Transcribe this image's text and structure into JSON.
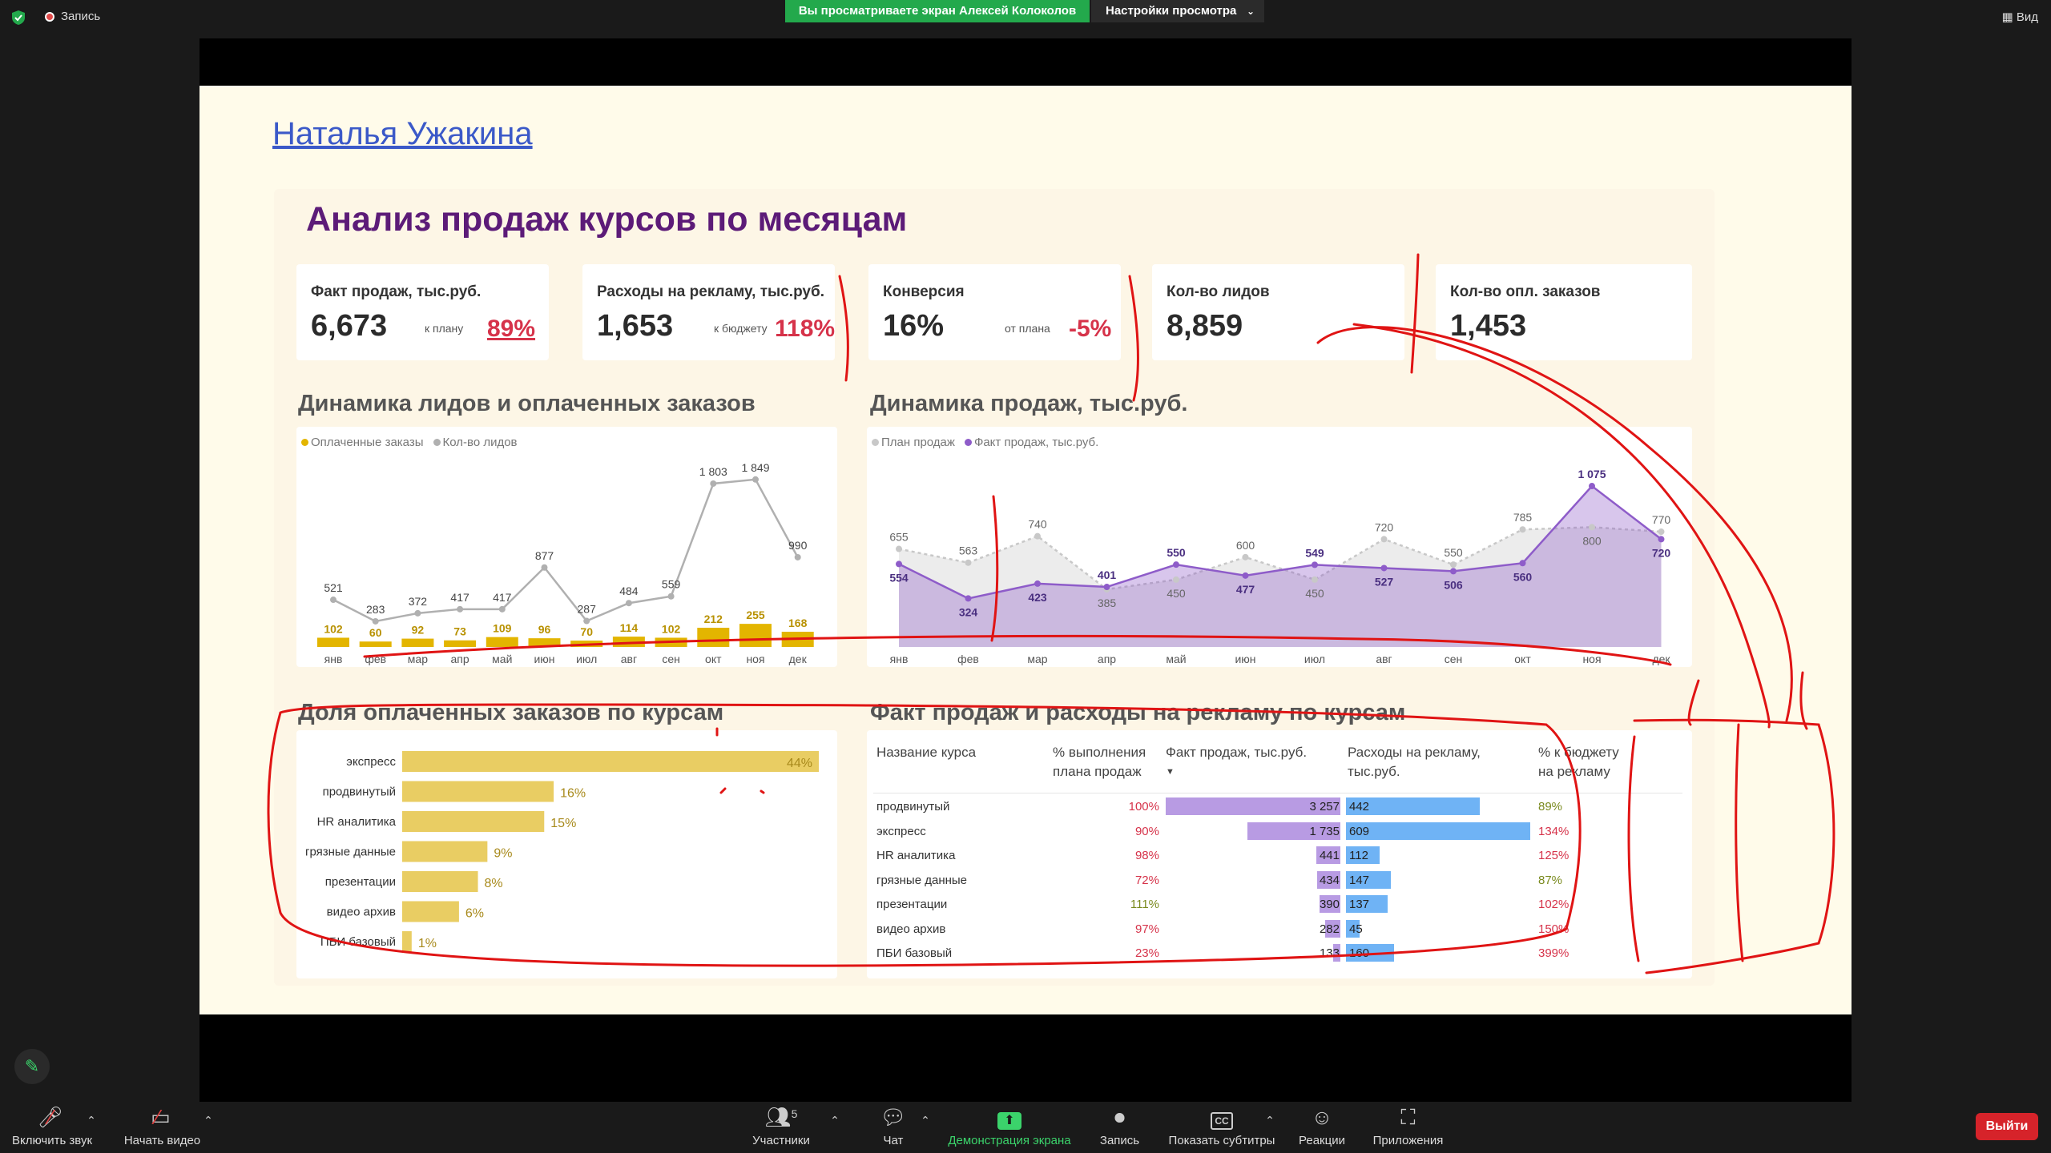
{
  "zoom": {
    "recording_label": "Запись",
    "banner_viewing": "Вы просматриваете экран Алексей Колоколов",
    "banner_settings": "Настройки просмотра",
    "view_label": "Вид",
    "toolbar": {
      "mute": "Включить звук",
      "video": "Начать видео",
      "participants": "Участники",
      "participants_count": "5",
      "chat": "Чат",
      "share": "Демонстрация экрана",
      "record": "Запись",
      "captions": "Показать субтитры",
      "reactions": "Реакции",
      "apps": "Приложения",
      "leave": "Выйти",
      "cc": "CC"
    },
    "colors": {
      "green": "#23a94c",
      "leave": "#d6232a"
    }
  },
  "slide": {
    "author": "Наталья Ужакина",
    "title": "Анализ продаж курсов по месяцам",
    "kpis": [
      {
        "label": "Факт продаж, тыс.руб.",
        "value": "6,673",
        "sub": "к плану",
        "pct": "89%"
      },
      {
        "label": "Расходы на рекламу, тыс.руб.",
        "value": "1,653",
        "sub": "к бюджету",
        "pct": "118%"
      },
      {
        "label": "Конверсия",
        "value": "16%",
        "sub": "от плана",
        "pct": "-5%"
      },
      {
        "label": "Кол-во лидов",
        "value": "8,859"
      },
      {
        "label": "Кол-во опл. заказов",
        "value": "1,453"
      }
    ],
    "leads_title": "Динамика лидов и оплаченных заказов",
    "sales_title": "Динамика продаж, тыс.руб.",
    "share_title": "Доля оплаченных заказов по курсам",
    "table_title": "Факт продаж и расходы на рекламу по курсам",
    "table_headers": {
      "course": "Название курса",
      "plan_pct_1": "% выполнения",
      "plan_pct_2": "плана продаж",
      "fact": "Факт продаж, тыс.руб.",
      "ads_1": "Расходы на рекламу,",
      "ads_2": "тыс.руб.",
      "budget_1": "% к бюджету",
      "budget_2": "на рекламу",
      "sort_icon": "▼"
    }
  },
  "chart_data": [
    {
      "type": "line",
      "title": "Динамика лидов и оплаченных заказов",
      "categories": [
        "янв",
        "фев",
        "мар",
        "апр",
        "май",
        "июн",
        "июл",
        "авг",
        "сен",
        "окт",
        "ноя",
        "дек"
      ],
      "series": [
        {
          "name": "Оплаченные заказы",
          "kind": "bar",
          "color": "#e3b500",
          "values": [
            102,
            60,
            92,
            73,
            109,
            96,
            70,
            114,
            102,
            212,
            255,
            168
          ]
        },
        {
          "name": "Кол-во лидов",
          "kind": "line",
          "color": "#b0b0b0",
          "values": [
            521,
            283,
            372,
            417,
            417,
            877,
            287,
            484,
            559,
            1803,
            1849,
            990
          ]
        }
      ],
      "legend": "top-left"
    },
    {
      "type": "area",
      "title": "Динамика продаж, тыс.руб.",
      "categories": [
        "янв",
        "фев",
        "мар",
        "апр",
        "май",
        "июн",
        "июл",
        "авг",
        "сен",
        "окт",
        "ноя",
        "дек"
      ],
      "series": [
        {
          "name": "План продаж",
          "color": "#c8c8c8",
          "values": [
            655,
            563,
            740,
            385,
            450,
            600,
            450,
            720,
            550,
            785,
            800,
            770
          ]
        },
        {
          "name": "Факт продаж, тыс.руб.",
          "color": "#8e5cc9",
          "values": [
            554,
            324,
            423,
            401,
            550,
            477,
            549,
            527,
            506,
            560,
            1075,
            720
          ]
        }
      ],
      "legend": "top-left"
    },
    {
      "type": "bar",
      "orientation": "horizontal",
      "title": "Доля оплаченных заказов по курсам",
      "categories": [
        "экспресс",
        "продвинутый",
        "HR аналитика",
        "грязные данные",
        "презентации",
        "видео архив",
        "ПБИ базовый"
      ],
      "values": [
        44,
        16,
        15,
        9,
        8,
        6,
        1
      ],
      "labels": [
        "44%",
        "16%",
        "15%",
        "9%",
        "8%",
        "6%",
        "1%"
      ],
      "color": "#e9cd63"
    },
    {
      "type": "table",
      "title": "Факт продаж и расходы на рекламу по курсам",
      "columns": [
        "Название курса",
        "% выполнения плана продаж",
        "Факт продаж, тыс.руб.",
        "Расходы на рекламу, тыс.руб.",
        "% к бюджету на рекламу"
      ],
      "rows": [
        {
          "course": "продвинутый",
          "plan": "100%",
          "plan_color": "#d6334a",
          "fact": 3257,
          "fact_label": "3 257",
          "ads": 442,
          "budget": "89%",
          "budget_color": "#7a8a1e"
        },
        {
          "course": "экспресс",
          "plan": "90%",
          "plan_color": "#d6334a",
          "fact": 1735,
          "fact_label": "1 735",
          "ads": 609,
          "budget": "134%",
          "budget_color": "#d6334a"
        },
        {
          "course": "HR аналитика",
          "plan": "98%",
          "plan_color": "#d6334a",
          "fact": 441,
          "fact_label": "441",
          "ads": 112,
          "budget": "125%",
          "budget_color": "#d6334a"
        },
        {
          "course": "грязные данные",
          "plan": "72%",
          "plan_color": "#d6334a",
          "fact": 434,
          "fact_label": "434",
          "ads": 147,
          "budget": "87%",
          "budget_color": "#7a8a1e"
        },
        {
          "course": "презентации",
          "plan": "111%",
          "plan_color": "#7a8a1e",
          "fact": 390,
          "fact_label": "390",
          "ads": 137,
          "budget": "102%",
          "budget_color": "#d6334a"
        },
        {
          "course": "видео архив",
          "plan": "97%",
          "plan_color": "#d6334a",
          "fact": 282,
          "fact_label": "282",
          "ads": 45,
          "budget": "150%",
          "budget_color": "#d6334a"
        },
        {
          "course": "ПБИ базовый",
          "plan": "23%",
          "plan_color": "#d6334a",
          "fact": 133,
          "fact_label": "133",
          "ads": 160,
          "budget": "399%",
          "budget_color": "#d6334a"
        }
      ],
      "fact_color": "#b89be3",
      "ads_color": "#6fb3f5"
    }
  ]
}
